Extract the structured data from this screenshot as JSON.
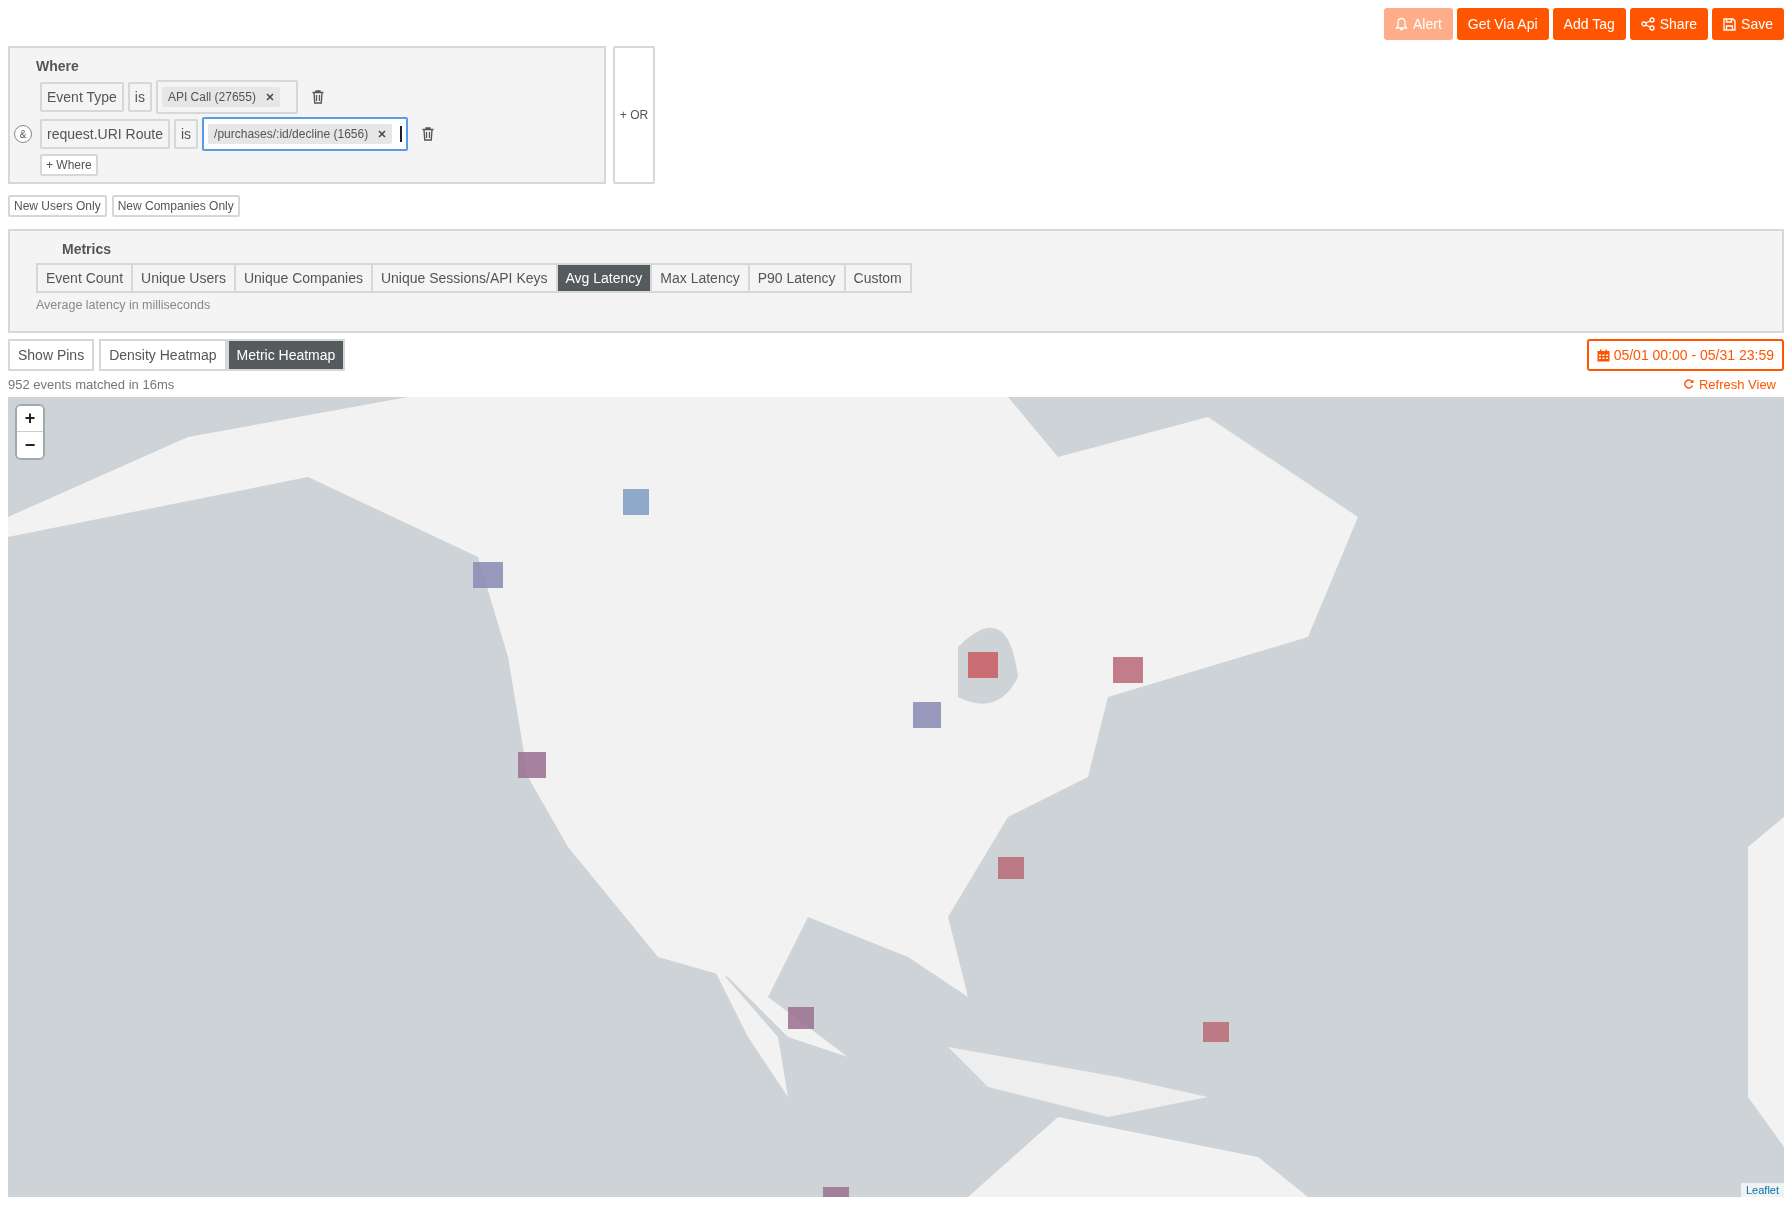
{
  "toolbar": {
    "buttons": [
      {
        "label": "Alert",
        "kind": "alert",
        "disabled": true
      },
      {
        "label": "Get Via Api",
        "kind": "plain",
        "disabled": false
      },
      {
        "label": "Add Tag",
        "kind": "plain",
        "disabled": false
      },
      {
        "label": "Share",
        "kind": "share",
        "disabled": false
      },
      {
        "label": "Save",
        "kind": "save",
        "disabled": false
      }
    ]
  },
  "where": {
    "title": "Where",
    "conditions": [
      {
        "field": "Event Type",
        "operator": "is",
        "value": "API Call (27655)",
        "focused": false
      },
      {
        "connector": "&",
        "field": "request.URI Route",
        "operator": "is",
        "value": "/purchases/:id/decline (1656)",
        "focused": true
      }
    ],
    "add_label": "+ Where",
    "or_label": "+ OR"
  },
  "filters": [
    "New Users Only",
    "New Companies Only"
  ],
  "metrics": {
    "title": "Metrics",
    "tabs": [
      {
        "label": "Event Count",
        "selected": false
      },
      {
        "label": "Unique Users",
        "selected": false
      },
      {
        "label": "Unique Companies",
        "selected": false
      },
      {
        "label": "Unique Sessions/API Keys",
        "selected": false
      },
      {
        "label": "Avg Latency",
        "selected": true
      },
      {
        "label": "Max Latency",
        "selected": false
      },
      {
        "label": "P90 Latency",
        "selected": false
      },
      {
        "label": "Custom",
        "selected": false
      }
    ],
    "description": "Average latency in milliseconds"
  },
  "view_modes": [
    {
      "label": "Show Pins",
      "selected": false
    },
    {
      "label": "Density Heatmap",
      "selected": false
    },
    {
      "label": "Metric Heatmap",
      "selected": true
    }
  ],
  "date_range": "05/01 00:00 - 05/31 23:59",
  "status": "952 events matched in 16ms",
  "refresh_label": "Refresh View",
  "map": {
    "kind": "picture",
    "zoom_in": "+",
    "zoom_out": "−",
    "attribution": "Leaflet"
  }
}
